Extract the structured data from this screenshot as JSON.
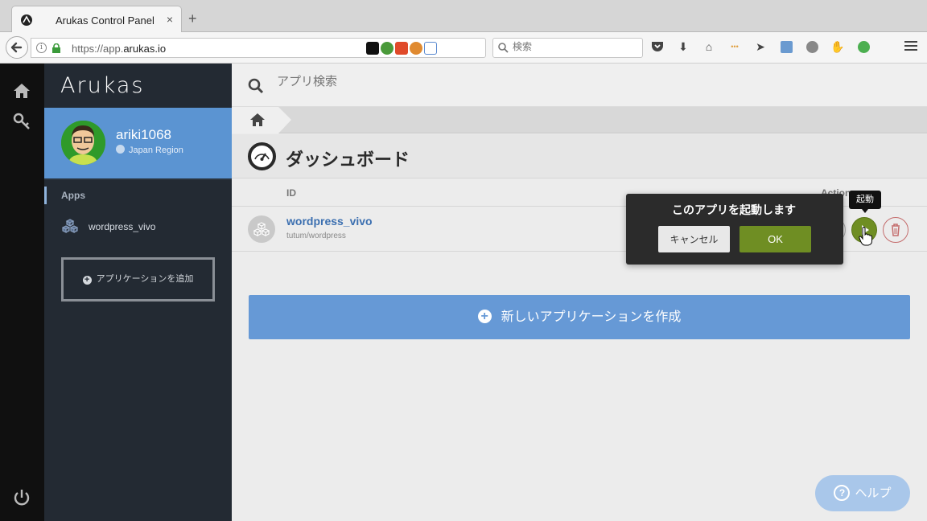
{
  "browser": {
    "tab_title": "Arukas Control Panel",
    "new_tab_symbol": "+",
    "close_symbol": "×",
    "url_prefix": "https://app.",
    "url_domain": "arukas.io",
    "search_placeholder": "検索"
  },
  "sidebar": {
    "logo": "Arukas",
    "username": "ariki1068",
    "region": "Japan Region",
    "apps_label": "Apps",
    "apps": [
      {
        "name": "wordpress_vivo"
      }
    ],
    "add_app_label": "アプリケーションを追加"
  },
  "main": {
    "search_placeholder": "アプリ検索",
    "page_title": "ダッシュボード",
    "table": {
      "col_id": "ID",
      "col_actions": "Actions",
      "rows": [
        {
          "name": "wordpress_vivo",
          "image": "tutum/wordpress"
        }
      ]
    },
    "create_label": "新しいアプリケーションを作成",
    "help_label": "ヘルプ"
  },
  "popover": {
    "message": "このアプリを起動します",
    "cancel_label": "キャンセル",
    "ok_label": "OK"
  },
  "tooltip": {
    "text": "起動"
  },
  "colors": {
    "accent_blue": "#6699d6",
    "profile_blue": "#5b94d2",
    "run_green": "#6f8e23",
    "sidebar_bg": "#232a33"
  }
}
